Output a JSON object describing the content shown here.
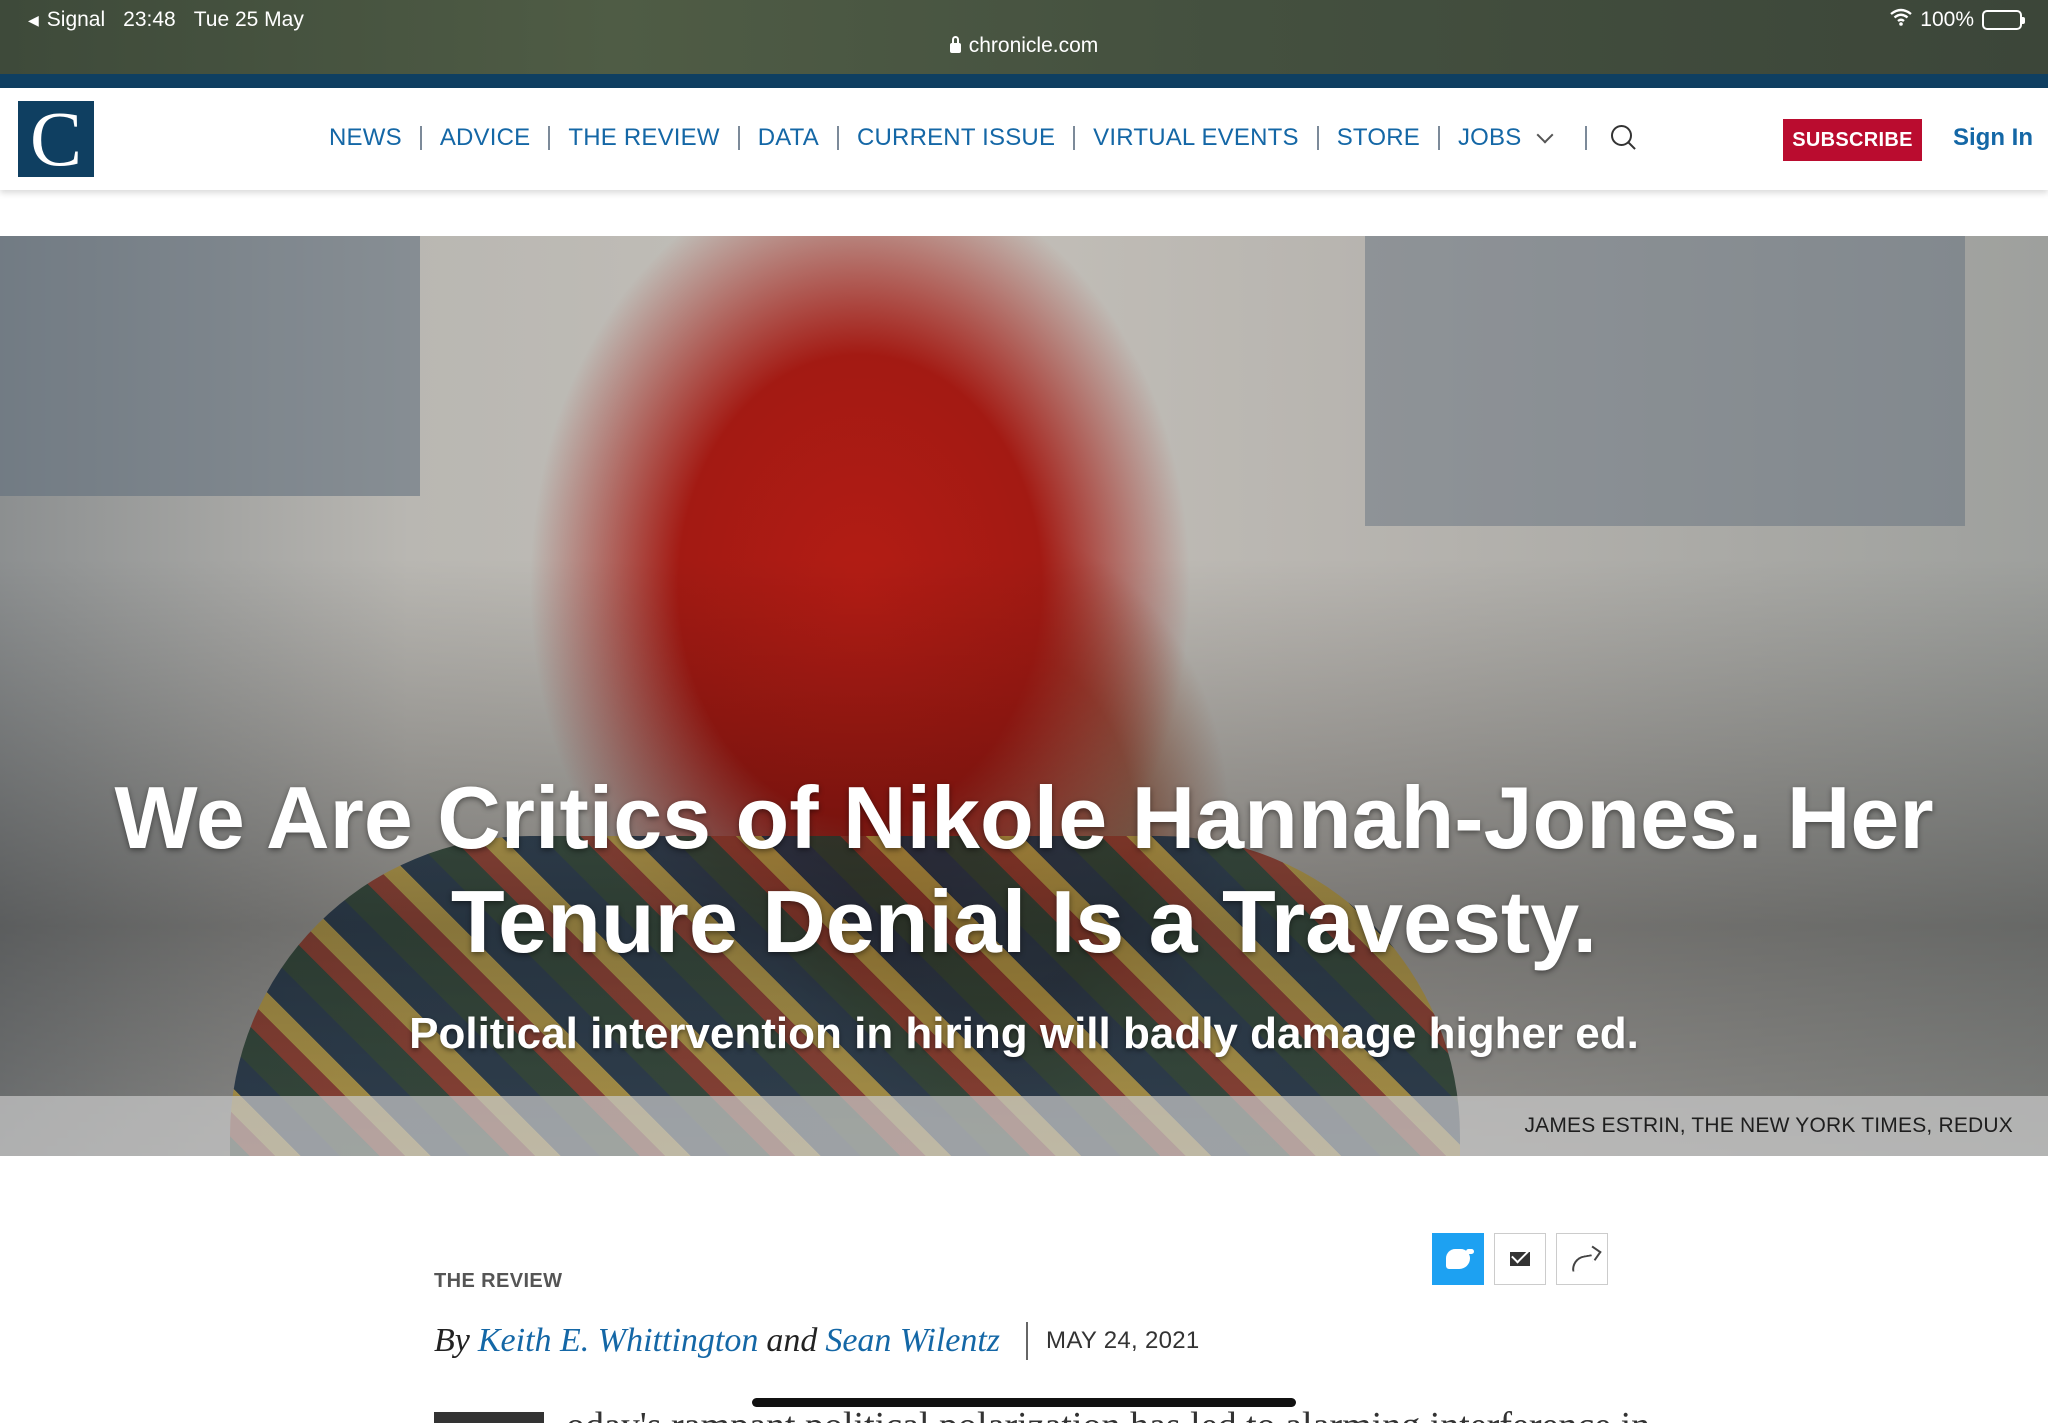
{
  "status_bar": {
    "back_app": "Signal",
    "time": "23:48",
    "date": "Tue 25 May",
    "battery": "100%",
    "url": "chronicle.com"
  },
  "nav": {
    "logo_letter": "C",
    "items": [
      "NEWS",
      "ADVICE",
      "THE REVIEW",
      "DATA",
      "CURRENT ISSUE",
      "VIRTUAL EVENTS",
      "STORE",
      "JOBS"
    ],
    "subscribe": "SUBSCRIBE",
    "sign_in": "Sign In"
  },
  "hero": {
    "title": "We Are Critics of Nikole Hannah-Jones. Her Tenure Denial Is a Travesty.",
    "subtitle": "Political intervention in hiring will badly damage higher ed.",
    "credit": "JAMES ESTRIN, THE NEW YORK TIMES, REDUX"
  },
  "article": {
    "section": "THE REVIEW",
    "by": "By",
    "author1": "Keith E. Whittington",
    "and": "and",
    "author2": "Sean Wilentz",
    "date": "MAY 24, 2021",
    "body_peek": "oday's rampant political polarization has led to alarming interference in"
  },
  "colors": {
    "brand_navy": "#0f3f61",
    "link_blue": "#1467a6",
    "subscribe_red": "#ba0c2f",
    "twitter_blue": "#1da1f2"
  },
  "icons": [
    "lock-icon",
    "wifi-icon",
    "battery-icon",
    "chevron-down-icon",
    "search-icon",
    "twitter-icon",
    "mail-icon",
    "share-icon"
  ]
}
